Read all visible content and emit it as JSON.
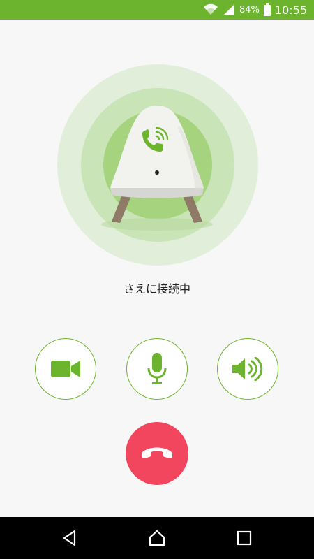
{
  "colors": {
    "accent": "#6cb42e",
    "hangup": "#f2455e",
    "background": "#f7f7f7"
  },
  "status_bar": {
    "battery_percent": "84%",
    "time": "10:55",
    "icons": [
      "wifi-icon",
      "signal-icon",
      "battery-icon"
    ]
  },
  "call": {
    "status_text": "さえに接続中",
    "device_icon": "phone-ringing-icon"
  },
  "controls": [
    {
      "name": "video-camera-icon"
    },
    {
      "name": "microphone-icon"
    },
    {
      "name": "speaker-icon"
    }
  ],
  "hangup": {
    "icon": "phone-hangup-icon"
  },
  "nav": {
    "icons": [
      "back-icon",
      "home-icon",
      "recent-apps-icon"
    ]
  }
}
